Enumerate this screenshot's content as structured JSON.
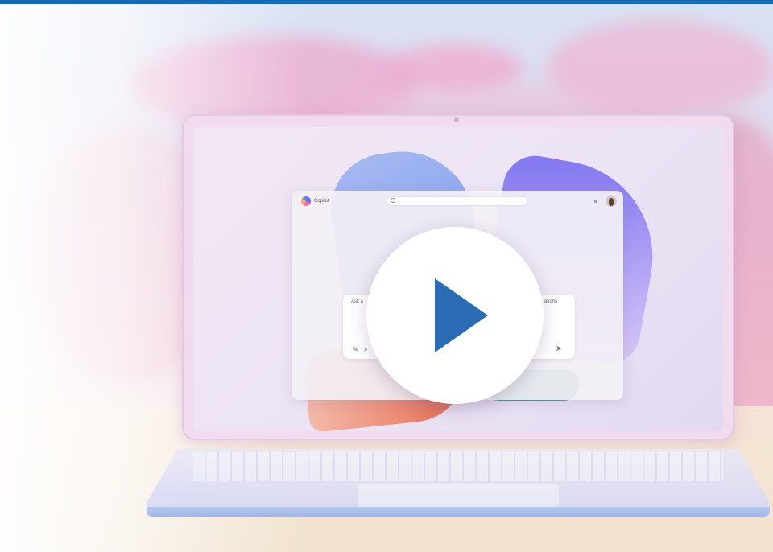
{
  "colors": {
    "accent_bar": "#0f6cbd",
    "play_icon": "#2a6cb3",
    "play_button_bg": "#ffffff"
  },
  "video": {
    "play_icon_name": "play-icon"
  },
  "screen_app": {
    "title": "Copilot",
    "chat_placeholder": "Ask a",
    "chat_right_text": "ations"
  }
}
